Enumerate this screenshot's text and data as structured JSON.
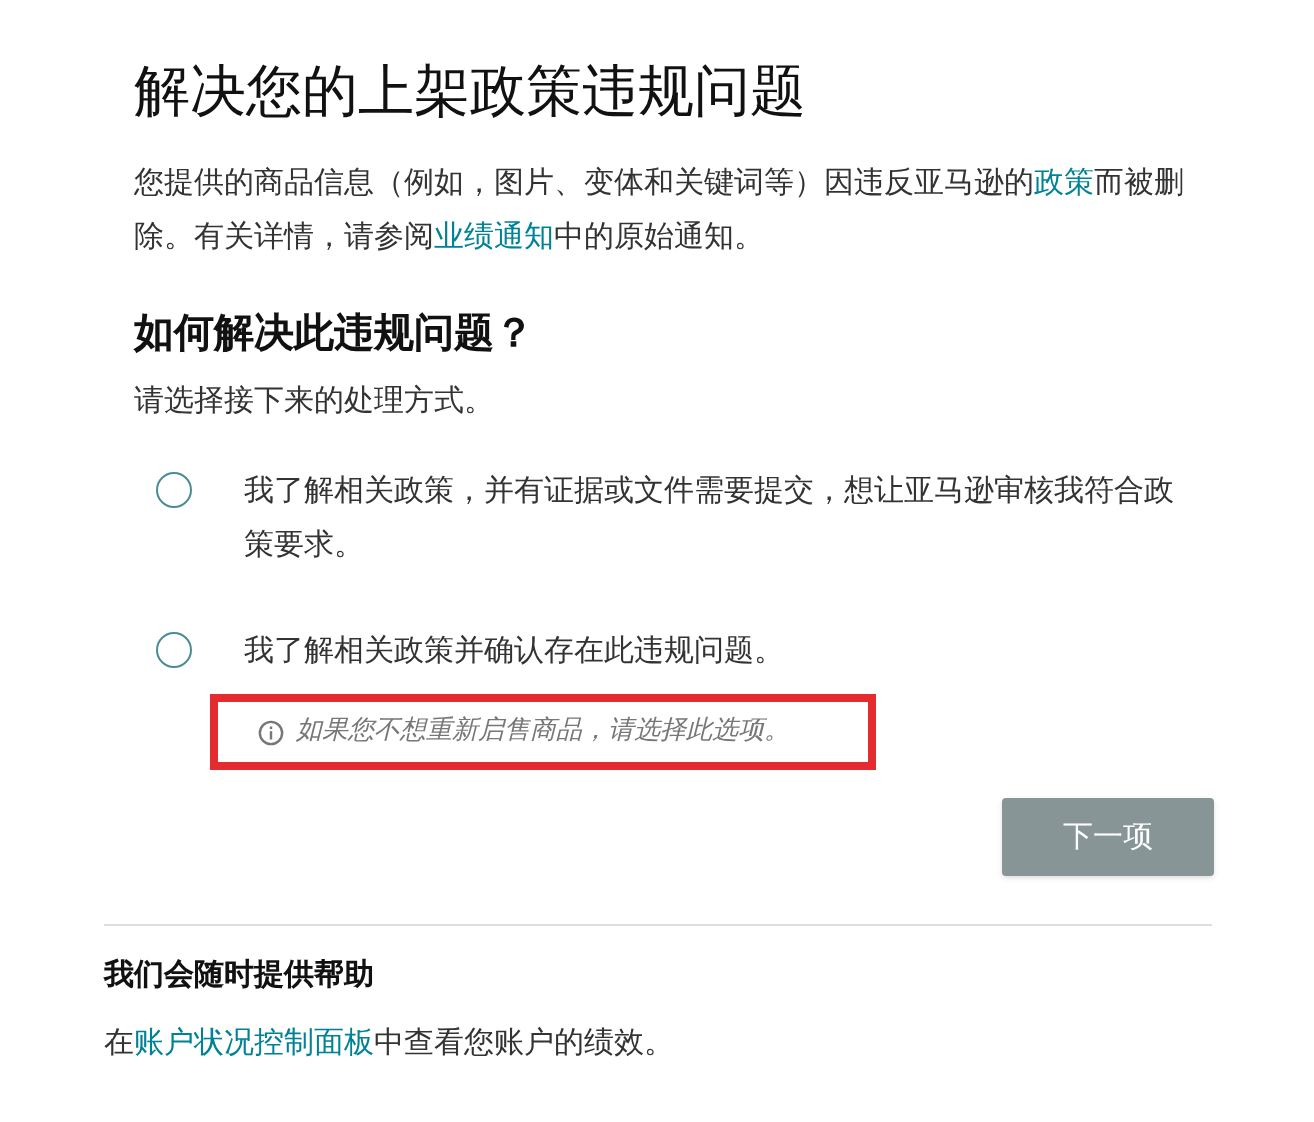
{
  "title": "解决您的上架政策违规问题",
  "intro": [
    {
      "kind": "text",
      "text": "您提供的商品信息（例如，图片、变体和关键词等）因违反亚马逊的"
    },
    {
      "kind": "link",
      "text": "政策"
    },
    {
      "kind": "text",
      "text": "而被删除。有关详情，请参阅"
    },
    {
      "kind": "link",
      "text": "业绩通知"
    },
    {
      "kind": "text",
      "text": "中的原始通知。"
    }
  ],
  "question": "如何解决此违规问题？",
  "instruction": "请选择接下来的处理方式。",
  "options": [
    {
      "label": "我了解相关政策，并有证据或文件需要提交，想让亚马逊审核我符合政策要求。",
      "selected": false
    },
    {
      "label": "我了解相关政策并确认存在此违规问题。",
      "selected": false,
      "hint": {
        "text": "如果您不想重新启售商品，请选择此选项。",
        "highlighted": true
      }
    }
  ],
  "next_button": {
    "label": "下一项",
    "disabled": true
  },
  "help": {
    "title": "我们会随时提供帮助",
    "text": [
      {
        "kind": "text",
        "text": "在"
      },
      {
        "kind": "link",
        "text": "账户状况控制面板"
      },
      {
        "kind": "text",
        "text": "中查看您账户的绩效。"
      }
    ]
  }
}
